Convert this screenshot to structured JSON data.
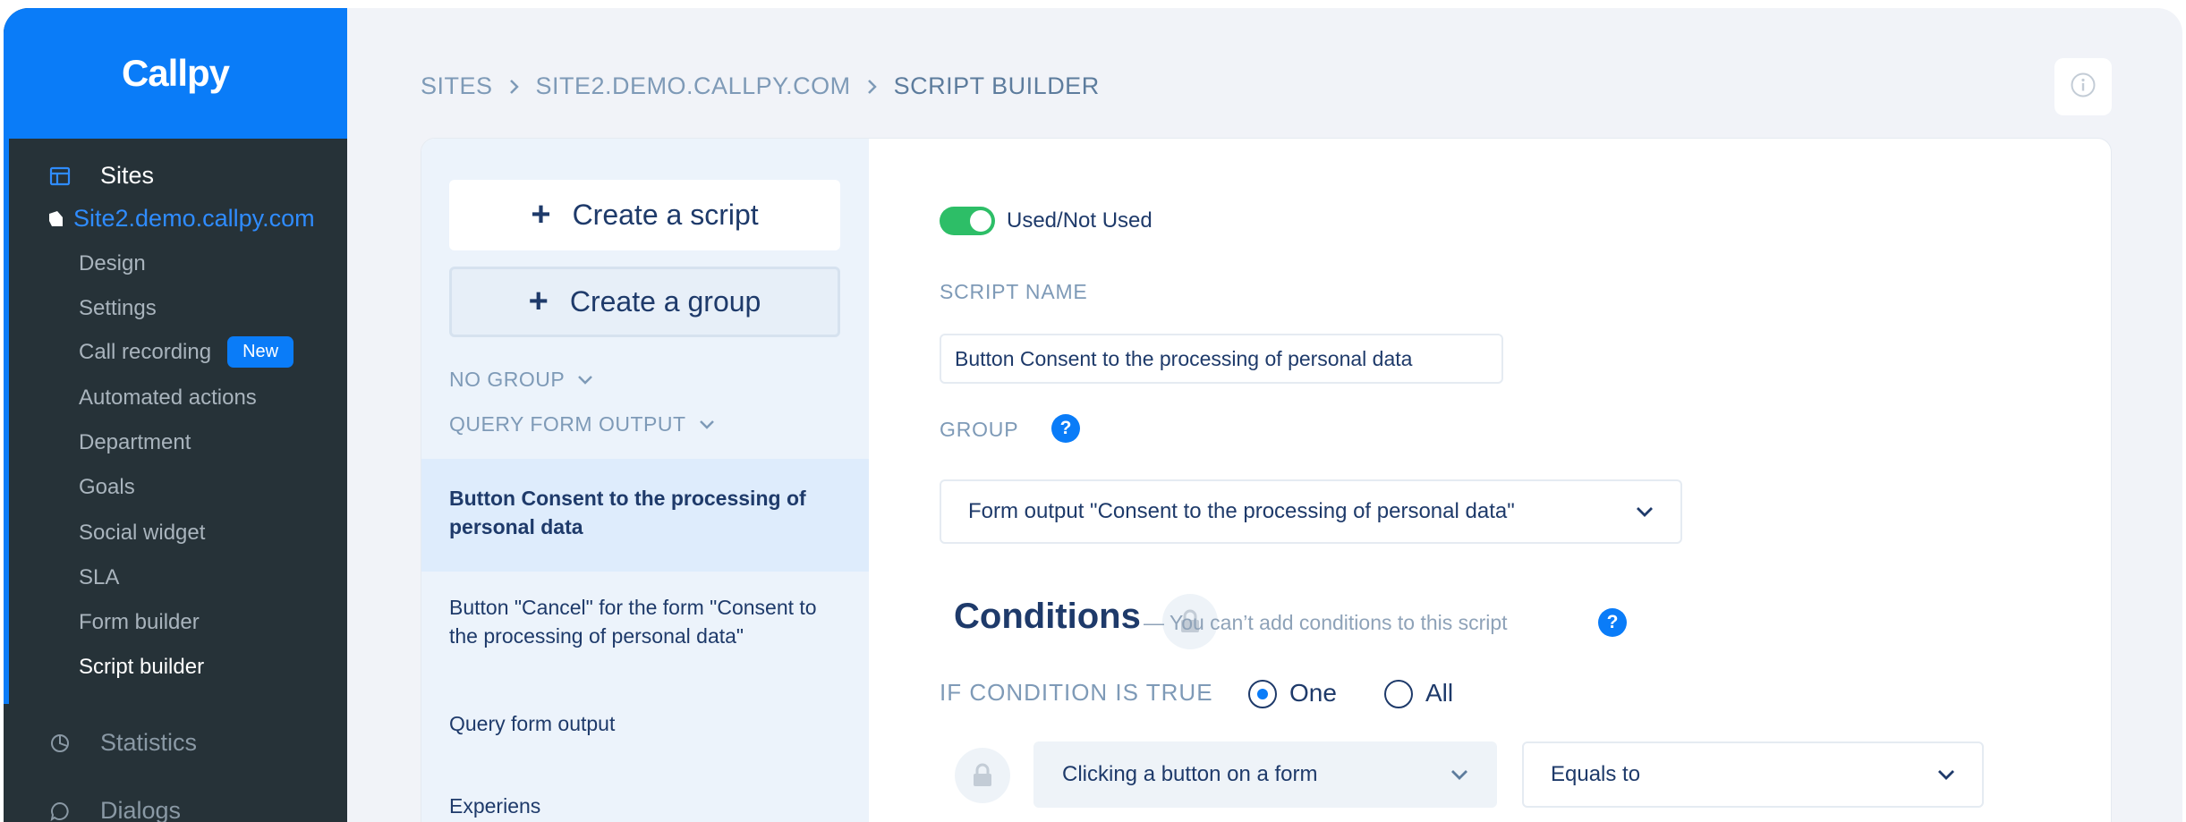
{
  "app": {
    "logo": "Callpy"
  },
  "sidebar": {
    "sites_label": "Sites",
    "site_name": "Site2.demo.callpy.com",
    "sub_items": [
      {
        "label": "Design"
      },
      {
        "label": "Settings"
      },
      {
        "label": "Call recording",
        "badge": "New"
      },
      {
        "label": "Automated actions"
      },
      {
        "label": "Department"
      },
      {
        "label": "Goals"
      },
      {
        "label": "Social widget"
      },
      {
        "label": "SLA"
      },
      {
        "label": "Form builder"
      },
      {
        "label": "Script builder"
      }
    ],
    "statistics_label": "Statistics",
    "dialogs_label": "Dialogs"
  },
  "breadcrumb": {
    "items": [
      "SITES",
      "SITE2.DEMO.CALLPY.COM",
      "SCRIPT BUILDER"
    ]
  },
  "scripts_panel": {
    "create_script_label": "Create a script",
    "create_group_label": "Create a group",
    "groups": [
      {
        "label": "NO GROUP"
      },
      {
        "label": "QUERY FORM OUTPUT"
      }
    ],
    "scripts": [
      {
        "label": "Button Consent to the processing of personal data",
        "selected": true
      },
      {
        "label": "Button \"Cancel\" for the form \"Consent to the processing of personal data\"",
        "selected": false
      },
      {
        "label": "Query form output",
        "selected": false
      },
      {
        "label": "Experiens",
        "selected": false
      }
    ]
  },
  "editor": {
    "toggle_label": "Used/Not Used",
    "toggle_on": true,
    "script_name_label": "SCRIPT NAME",
    "script_name_value": "Button Consent to the processing of personal data",
    "group_label": "GROUP",
    "help_glyph": "?",
    "group_value": "Form output \"Consent to the processing of personal data\"",
    "conditions_title": "Conditions",
    "conditions_hint": "— You can’t add conditions to this script",
    "if_condition_label": "IF CONDITION IS TRUE",
    "radio_one_label": "One",
    "radio_all_label": "All",
    "radio_selected": "One",
    "condition_type_value": "Clicking a button on a form",
    "condition_operator_value": "Equals to"
  },
  "colors": {
    "accent": "#0a7cf8",
    "sidebar_bg": "#263238",
    "toggle_on": "#2dbe67",
    "text_dark": "#1e3a6a"
  }
}
